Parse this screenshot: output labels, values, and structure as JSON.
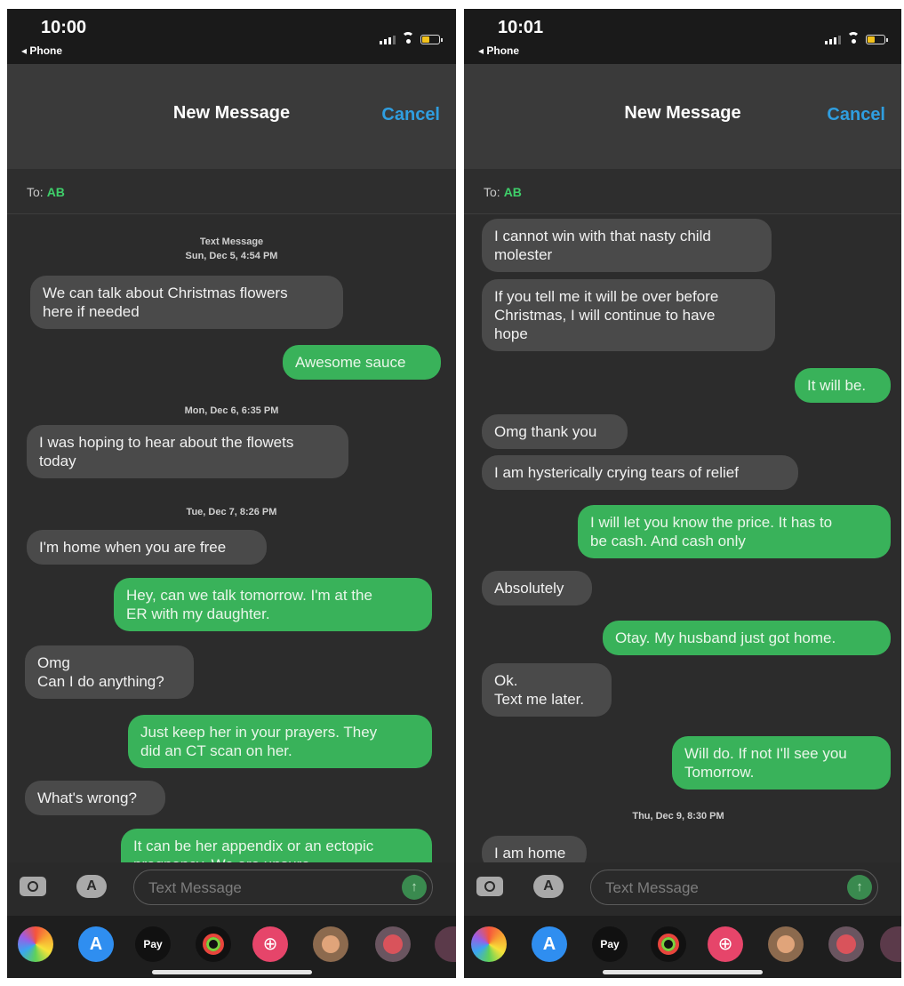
{
  "left": {
    "status": {
      "time": "10:00",
      "back_label": "◂ Phone"
    },
    "header": {
      "title": "New Message",
      "cancel_label": "Cancel"
    },
    "to": {
      "label": "To:",
      "recipient": "AB"
    },
    "thread": {
      "stamp1": "Text Message\nSun, Dec 5, 4:54 PM",
      "m1": "We can talk about Christmas flowers\nhere if needed",
      "m2": "Awesome sauce",
      "stamp2": "Mon, Dec 6, 6:35 PM",
      "m3": "I was hoping to hear about the flowets\ntoday",
      "stamp3": "Tue, Dec 7, 8:26 PM",
      "m4": "I'm home when you are free",
      "m5": "Hey, can we talk tomorrow. I'm at the\nER with my daughter.",
      "m6": "Omg\nCan I do anything?",
      "m7": "Just keep her in your prayers. They\ndid an CT scan on her.",
      "m8": "What's wrong?",
      "m9": "It can be her appendix or an ectopic\npregnancy. We are unsure"
    },
    "composer": {
      "placeholder": "Text Message"
    }
  },
  "right": {
    "status": {
      "time": "10:01",
      "back_label": "◂ Phone"
    },
    "header": {
      "title": "New Message",
      "cancel_label": "Cancel"
    },
    "to": {
      "label": "To:",
      "recipient": "AB"
    },
    "thread": {
      "m1": "I cannot win with that nasty child\nmolester",
      "m2": "If you tell me it will be over before\nChristmas, I will continue to have\nhope",
      "m3": "It will be.",
      "m4": "Omg thank you",
      "m5": "I am hysterically crying tears of relief",
      "m6": "I will let you know the price. It has to\nbe cash. And cash only",
      "m7": "Absolutely",
      "m8": "Otay. My husband just got home.",
      "m9": "Ok.\nText me later.",
      "m10": "Will do. If not I'll see you\nTomorrow.",
      "stamp1": "Thu, Dec 9, 8:30 PM",
      "m11": "I am home"
    },
    "composer": {
      "placeholder": "Text Message"
    }
  },
  "icons": [
    "photos-icon",
    "app-store-icon",
    "apple-pay-icon",
    "fitness-icon",
    "image-search-icon",
    "memoji-icon",
    "sticker-icon"
  ],
  "apps": {
    "pay_label": "Pay"
  },
  "colors": {
    "sent_bubble": "#39b25a",
    "received_bubble": "#4a4a4a",
    "accent_blue": "#2f9ee0",
    "recipient_green": "#3fcf6a"
  }
}
